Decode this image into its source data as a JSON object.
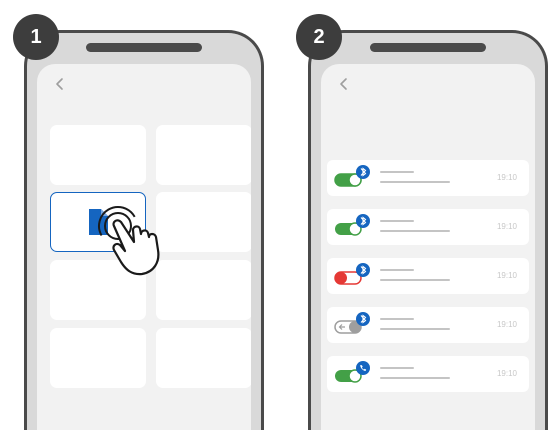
{
  "steps": [
    {
      "number": "1",
      "back_glyph": "‹"
    },
    {
      "number": "2",
      "back_glyph": "‹"
    }
  ],
  "rows": [
    {
      "time": "19:10",
      "toggle": "on",
      "toggle_color": "#43a047",
      "badge_icon": "bluetooth-icon"
    },
    {
      "time": "19:10",
      "toggle": "on",
      "toggle_color": "#43a047",
      "badge_icon": "bluetooth-icon"
    },
    {
      "time": "19:10",
      "toggle": "off",
      "toggle_color": "#e53935",
      "badge_icon": "bluetooth-icon"
    },
    {
      "time": "19:10",
      "toggle": "unavailable",
      "toggle_color": "#9e9e9e",
      "badge_icon": "bluetooth-icon"
    },
    {
      "time": "19:10",
      "toggle": "on",
      "toggle_color": "#43a047",
      "badge_icon": "phone-icon"
    }
  ],
  "colors": {
    "accent": "#1565c0",
    "frame": "#4a4a4a",
    "screen": "#f2f2f2"
  }
}
